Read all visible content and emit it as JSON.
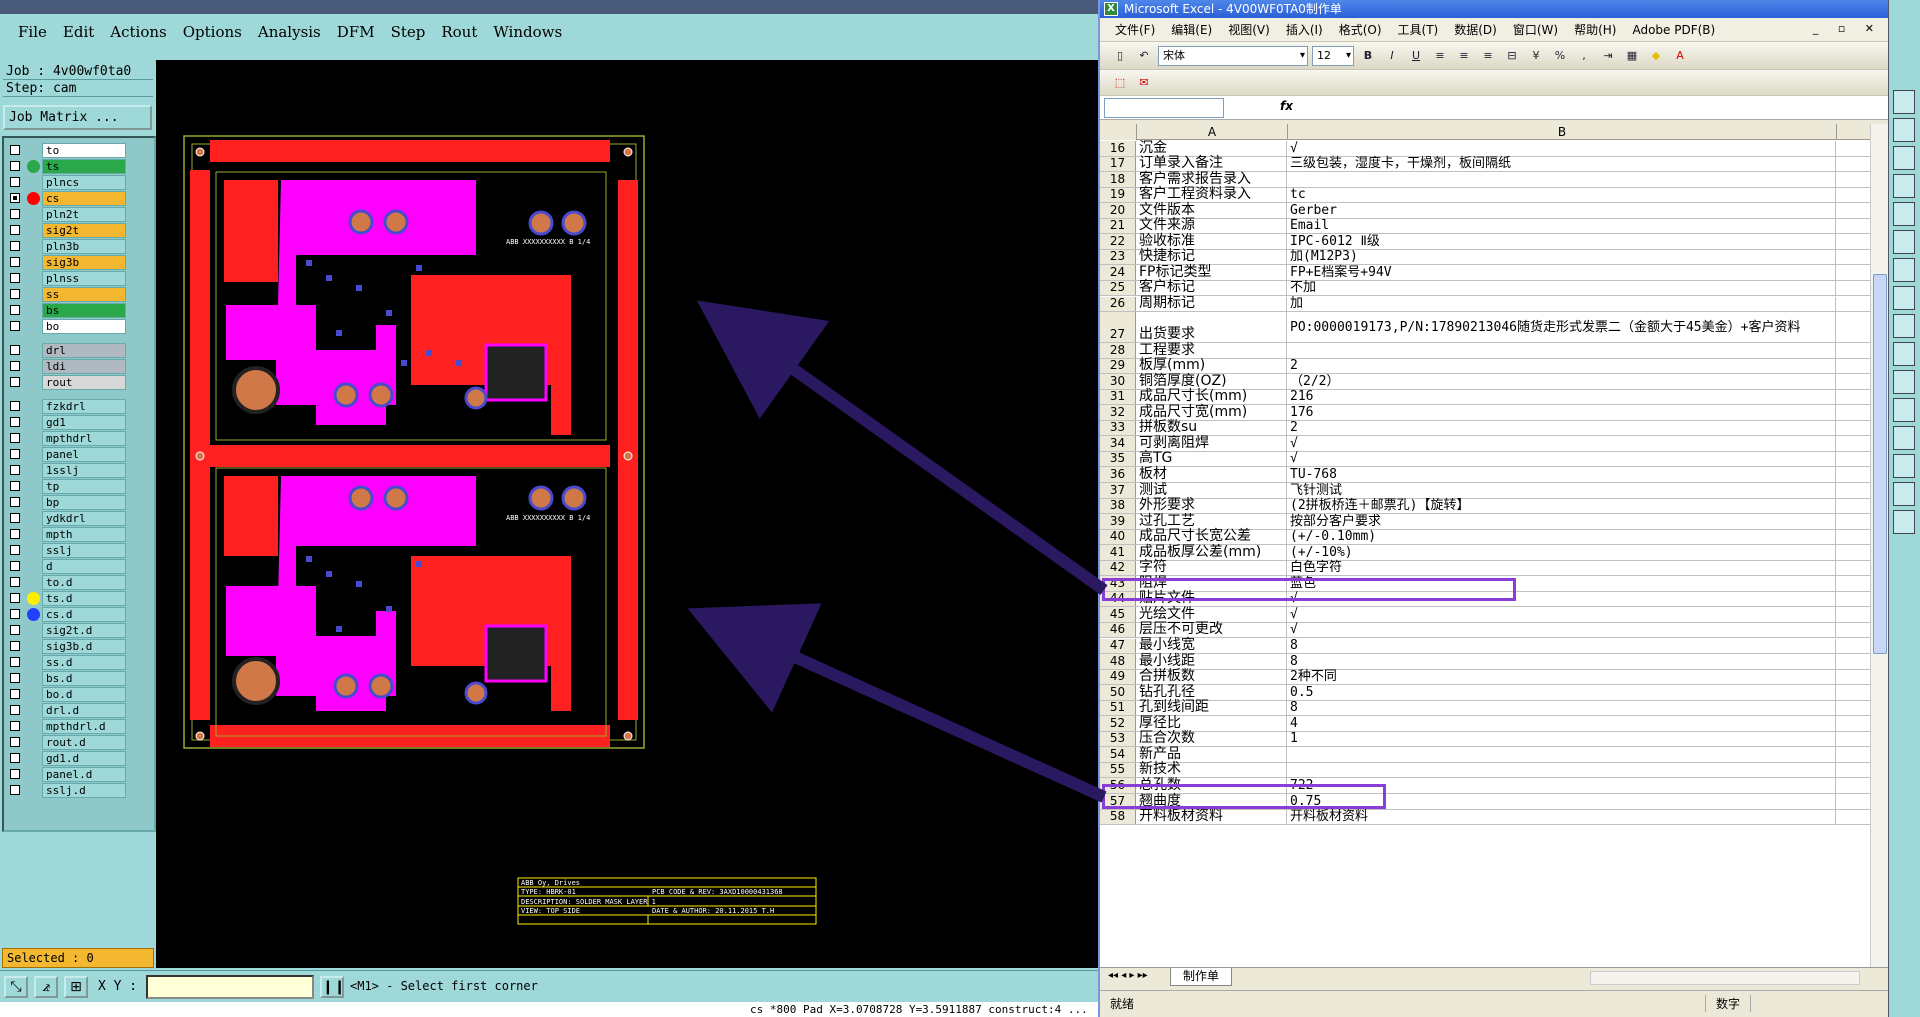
{
  "cam": {
    "menu": [
      "File",
      "Edit",
      "Actions",
      "Options",
      "Analysis",
      "DFM",
      "Step",
      "Rout",
      "Windows"
    ],
    "job_label": "Job : 4v00wf0ta0",
    "step_label": "Step: cam",
    "job_matrix_button": "Job Matrix ...",
    "layers": [
      {
        "name": "to",
        "bg": "#ffffff",
        "dot": "",
        "on": false,
        "mark": false
      },
      {
        "name": "ts",
        "bg": "#2aa84a",
        "dot": "#2aa84a",
        "on": false,
        "mark": false
      },
      {
        "name": "plncs",
        "bg": "#9fd8d8",
        "dot": "",
        "on": false,
        "mark": false
      },
      {
        "name": "cs",
        "bg": "#f4b830",
        "dot": "#ff0000",
        "on": true,
        "mark": true
      },
      {
        "name": "pln2t",
        "bg": "#9fd8d8",
        "dot": "",
        "on": false,
        "mark": false
      },
      {
        "name": "sig2t",
        "bg": "#f4b830",
        "dot": "",
        "on": false,
        "mark": true
      },
      {
        "name": "pln3b",
        "bg": "#9fd8d8",
        "dot": "",
        "on": false,
        "mark": false
      },
      {
        "name": "sig3b",
        "bg": "#f4b830",
        "dot": "",
        "on": false,
        "mark": true
      },
      {
        "name": "plnss",
        "bg": "#9fd8d8",
        "dot": "",
        "on": false,
        "mark": false
      },
      {
        "name": "ss",
        "bg": "#f4b830",
        "dot": "",
        "on": false,
        "mark": true
      },
      {
        "name": "bs",
        "bg": "#2aa84a",
        "dot": "",
        "on": false,
        "mark": false
      },
      {
        "name": "bo",
        "bg": "#ffffff",
        "dot": "",
        "on": false,
        "mark": false
      },
      {
        "name": "drl",
        "bg": "#b0b8c0",
        "dot": "",
        "on": false,
        "mark": false,
        "gap": true
      },
      {
        "name": "ldi",
        "bg": "#b0b8c0",
        "dot": "",
        "on": false,
        "mark": false
      },
      {
        "name": "rout",
        "bg": "#d8d8d8",
        "dot": "",
        "on": false,
        "mark": false
      },
      {
        "name": "fzkdrl",
        "bg": "#9fd8d8",
        "dot": "",
        "on": false,
        "mark": false,
        "gap": true
      },
      {
        "name": "gd1",
        "bg": "#9fd8d8",
        "dot": "",
        "on": false,
        "mark": true
      },
      {
        "name": "mpthdrl",
        "bg": "#9fd8d8",
        "dot": "",
        "on": false,
        "mark": false
      },
      {
        "name": "panel",
        "bg": "#9fd8d8",
        "dot": "",
        "on": false,
        "mark": false
      },
      {
        "name": "1sslj",
        "bg": "#9fd8d8",
        "dot": "",
        "on": false,
        "mark": false
      },
      {
        "name": "tp",
        "bg": "#9fd8d8",
        "dot": "",
        "on": false,
        "mark": false
      },
      {
        "name": "bp",
        "bg": "#9fd8d8",
        "dot": "",
        "on": false,
        "mark": false
      },
      {
        "name": "ydkdrl",
        "bg": "#9fd8d8",
        "dot": "",
        "on": false,
        "mark": false
      },
      {
        "name": "mpth",
        "bg": "#9fd8d8",
        "dot": "",
        "on": false,
        "mark": false
      },
      {
        "name": "sslj",
        "bg": "#9fd8d8",
        "dot": "",
        "on": false,
        "mark": false
      },
      {
        "name": "d",
        "bg": "#9fd8d8",
        "dot": "",
        "on": false,
        "mark": false
      },
      {
        "name": "to.d",
        "bg": "#9fd8d8",
        "dot": "",
        "on": false,
        "mark": false
      },
      {
        "name": "ts.d",
        "bg": "#9fd8d8",
        "dot": "#ffee00",
        "on": false,
        "mark": false
      },
      {
        "name": "cs.d",
        "bg": "#9fd8d8",
        "dot": "#2040ff",
        "on": false,
        "mark": true
      },
      {
        "name": "sig2t.d",
        "bg": "#9fd8d8",
        "dot": "",
        "on": false,
        "mark": true
      },
      {
        "name": "sig3b.d",
        "bg": "#9fd8d8",
        "dot": "",
        "on": false,
        "mark": true
      },
      {
        "name": "ss.d",
        "bg": "#9fd8d8",
        "dot": "",
        "on": false,
        "mark": true
      },
      {
        "name": "bs.d",
        "bg": "#9fd8d8",
        "dot": "",
        "on": false,
        "mark": false
      },
      {
        "name": "bo.d",
        "bg": "#9fd8d8",
        "dot": "",
        "on": false,
        "mark": false
      },
      {
        "name": "drl.d",
        "bg": "#9fd8d8",
        "dot": "",
        "on": false,
        "mark": false
      },
      {
        "name": "mpthdrl.d",
        "bg": "#9fd8d8",
        "dot": "",
        "on": false,
        "mark": false
      },
      {
        "name": "rout.d",
        "bg": "#9fd8d8",
        "dot": "",
        "on": false,
        "mark": false
      },
      {
        "name": "gd1.d",
        "bg": "#9fd8d8",
        "dot": "",
        "on": false,
        "mark": true
      },
      {
        "name": "panel.d",
        "bg": "#9fd8d8",
        "dot": "",
        "on": false,
        "mark": false
      },
      {
        "name": "sslj.d",
        "bg": "#9fd8d8",
        "dot": "",
        "on": false,
        "mark": false
      }
    ],
    "selected": "Selected : 0",
    "xy_label": "X Y :",
    "xy_value": "",
    "prompt": "<M1> - Select first corner",
    "status": "cs *800 Pad X=3.0708728 Y=3.5911887 construct:4 ...",
    "title_block": [
      "ABB Oy, Drives",
      "TYPE: HBRK-01",
      "PCB CODE & REV: 3AXD10000431368",
      "DESCRIPTION: SOLDER MASK LAYER 1",
      "VIEW: TOP SIDE",
      "DATE & AUTHOR: 20.11.2015 T.H",
      "ABB  XXXXXXXXXX B 1/4",
      "ABB  XXXXXXXXXX B 1/4"
    ],
    "colors": {
      "copper": "#ff2020",
      "mask": "#ff00ff",
      "pad": "#d07848",
      "outline": "#9aa830"
    }
  },
  "excel": {
    "title": "Microsoft Excel - 4V00WF0TA0制作单",
    "app_icon": "X",
    "menu": [
      "文件(F)",
      "编辑(E)",
      "视图(V)",
      "插入(I)",
      "格式(O)",
      "工具(T)",
      "数据(D)",
      "窗口(W)",
      "帮助(H)",
      "Adobe PDF(B)"
    ],
    "font_name": "宋体",
    "font_size": "12",
    "fx": "fx",
    "columns": [
      "A",
      "B"
    ],
    "rows": [
      {
        "n": "16",
        "a": "沉金",
        "b": "√"
      },
      {
        "n": "17",
        "a": "订单录入备注",
        "b": "三级包装，湿度卡，干燥剂，板间隔纸"
      },
      {
        "n": "18",
        "a": "客户需求报告录入",
        "b": ""
      },
      {
        "n": "19",
        "a": "客户工程资料录入",
        "b": "tc"
      },
      {
        "n": "20",
        "a": "文件版本",
        "b": "Gerber"
      },
      {
        "n": "21",
        "a": "文件来源",
        "b": "Email"
      },
      {
        "n": "22",
        "a": "验收标准",
        "b": "IPC-6012 Ⅱ级"
      },
      {
        "n": "23",
        "a": "快捷标记",
        "b": "加(M12P3)"
      },
      {
        "n": "24",
        "a": "FP标记类型",
        "b": "FP+E档案号+94V"
      },
      {
        "n": "25",
        "a": "客户标记",
        "b": "不加"
      },
      {
        "n": "26",
        "a": "周期标记",
        "b": "加"
      },
      {
        "n": "27",
        "a": "出货要求",
        "b": "PO:0000019173,P/N:17890213046随货走形式发票二（金额大于45美金）+客户资料",
        "tall": true
      },
      {
        "n": "28",
        "a": "工程要求",
        "b": ""
      },
      {
        "n": "29",
        "a": "板厚(mm)",
        "b": "2"
      },
      {
        "n": "30",
        "a": "铜箔厚度(OZ)",
        "b": "（2/2）"
      },
      {
        "n": "31",
        "a": "成品尺寸长(mm)",
        "b": "216"
      },
      {
        "n": "32",
        "a": "成品尺寸宽(mm)",
        "b": "176"
      },
      {
        "n": "33",
        "a": "拼板数su",
        "b": "2"
      },
      {
        "n": "34",
        "a": "可剥离阻焊",
        "b": "√"
      },
      {
        "n": "35",
        "a": "高TG",
        "b": "√"
      },
      {
        "n": "36",
        "a": "板材",
        "b": "TU-768"
      },
      {
        "n": "37",
        "a": "测试",
        "b": "飞针测试"
      },
      {
        "n": "38",
        "a": "外形要求",
        "b": "(2拼板桥连＋邮票孔)【旋转】"
      },
      {
        "n": "39",
        "a": "过孔工艺",
        "b": "按部分客户要求"
      },
      {
        "n": "40",
        "a": "成品尺寸长宽公差",
        "b": "(+/-0.10mm)"
      },
      {
        "n": "41",
        "a": "成品板厚公差(mm)",
        "b": "(+/-10%)"
      },
      {
        "n": "42",
        "a": "字符",
        "b": "白色字符"
      },
      {
        "n": "43",
        "a": "阻焊",
        "b": "蓝色"
      },
      {
        "n": "44",
        "a": "贴片文件",
        "b": "√"
      },
      {
        "n": "45",
        "a": "光绘文件",
        "b": "√"
      },
      {
        "n": "46",
        "a": "层压不可更改",
        "b": "√"
      },
      {
        "n": "47",
        "a": "最小线宽",
        "b": "8"
      },
      {
        "n": "48",
        "a": "最小线距",
        "b": "8"
      },
      {
        "n": "49",
        "a": "合拼板数",
        "b": "2种不同"
      },
      {
        "n": "50",
        "a": "钻孔孔径",
        "b": "0.5"
      },
      {
        "n": "51",
        "a": "孔到线间距",
        "b": "8"
      },
      {
        "n": "52",
        "a": "厚径比",
        "b": "4"
      },
      {
        "n": "53",
        "a": "压合次数",
        "b": "1"
      },
      {
        "n": "54",
        "a": "新产品",
        "b": ""
      },
      {
        "n": "55",
        "a": "新技术",
        "b": ""
      },
      {
        "n": "56",
        "a": "总孔数",
        "b": "722"
      },
      {
        "n": "57",
        "a": "翘曲度",
        "b": "0.75"
      },
      {
        "n": "58",
        "a": "开料板材资料",
        "b": "开料板材资料"
      }
    ],
    "sheet_tab": "制作单",
    "status_left": "就绪",
    "status_right": "数字"
  }
}
